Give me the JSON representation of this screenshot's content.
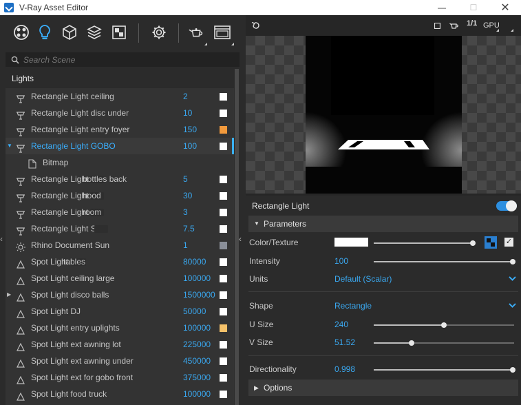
{
  "window": {
    "title": "V-Ray Asset Editor",
    "minimize": "—",
    "maximize": "☐",
    "close": "✕"
  },
  "search": {
    "placeholder": "Search Scene"
  },
  "lights_header": "Lights",
  "lights": [
    {
      "name": "Rectangle Light ceiling",
      "value": "2",
      "swatch": "#ffffff",
      "type": "rect"
    },
    {
      "name": "Rectangle Light disc under",
      "value": "10",
      "swatch": "#ffffff",
      "type": "rect"
    },
    {
      "name": "Rectangle Light entry foyer",
      "value": "150",
      "swatch": "#f39a3c",
      "type": "rect"
    },
    {
      "name": "Rectangle Light GOBO",
      "value": "100",
      "swatch": "#ffffff",
      "type": "rect",
      "selected": true,
      "expanded": true
    },
    {
      "name": "Bitmap",
      "value": "",
      "swatch": "",
      "type": "file",
      "child": true
    },
    {
      "name": "Rectangle Light",
      "suffix": "bottles back",
      "value": "5",
      "swatch": "#ffffff",
      "type": "rect"
    },
    {
      "name": "Rectangle Light",
      "suffix": "hood",
      "value": "30",
      "swatch": "#ffffff",
      "type": "rect"
    },
    {
      "name": "Rectangle Light",
      "suffix": "room",
      "value": "3",
      "swatch": "#ffffff",
      "type": "rect"
    },
    {
      "name": "Rectangle Light S",
      "value": "7.5",
      "swatch": "#ffffff",
      "type": "rect"
    },
    {
      "name": "Rhino Document Sun",
      "value": "1",
      "swatch": "#8a8f99",
      "type": "sun"
    },
    {
      "name": "Spot Light",
      "suffix": "tables",
      "value": "80000",
      "swatch": "#ffffff",
      "type": "spot"
    },
    {
      "name": "Spot Light ceiling large",
      "value": "100000",
      "swatch": "#ffffff",
      "type": "spot"
    },
    {
      "name": "Spot Light disco balls",
      "value": "1500000",
      "swatch": "#ffffff",
      "type": "spot",
      "collapsed": true
    },
    {
      "name": "Spot Light DJ",
      "value": "50000",
      "swatch": "#ffffff",
      "type": "spot"
    },
    {
      "name": "Spot Light entry uplights",
      "value": "100000",
      "swatch": "#f5c26a",
      "type": "spot"
    },
    {
      "name": "Spot Light ext awning lot",
      "value": "225000",
      "swatch": "#ffffff",
      "type": "spot"
    },
    {
      "name": "Spot Light ext awning under",
      "value": "450000",
      "swatch": "#ffffff",
      "type": "spot"
    },
    {
      "name": "Spot Light ext for gobo front",
      "value": "375000",
      "swatch": "#ffffff",
      "type": "spot"
    },
    {
      "name": "Spot Light food truck",
      "value": "100000",
      "swatch": "#ffffff",
      "type": "spot"
    }
  ],
  "render_toolbar": {
    "ratio": "1/1",
    "engine": "GPU"
  },
  "properties": {
    "title": "Rectangle Light",
    "enabled": true,
    "parameters_label": "Parameters",
    "color_label": "Color/Texture",
    "intensity_label": "Intensity",
    "intensity_value": "100",
    "intensity_slider": 1.0,
    "units_label": "Units",
    "units_value": "Default (Scalar)",
    "shape_label": "Shape",
    "shape_value": "Rectangle",
    "usize_label": "U Size",
    "usize_value": "240",
    "usize_slider": 0.5,
    "vsize_label": "V Size",
    "vsize_value": "51.52",
    "vsize_slider": 0.27,
    "directionality_label": "Directionality",
    "directionality_value": "0.998",
    "directionality_slider": 0.998,
    "options_label": "Options"
  },
  "colors": {
    "accent": "#3aa8f0",
    "selected_text": "#3ab0ff",
    "panel": "#2b2b2b"
  }
}
